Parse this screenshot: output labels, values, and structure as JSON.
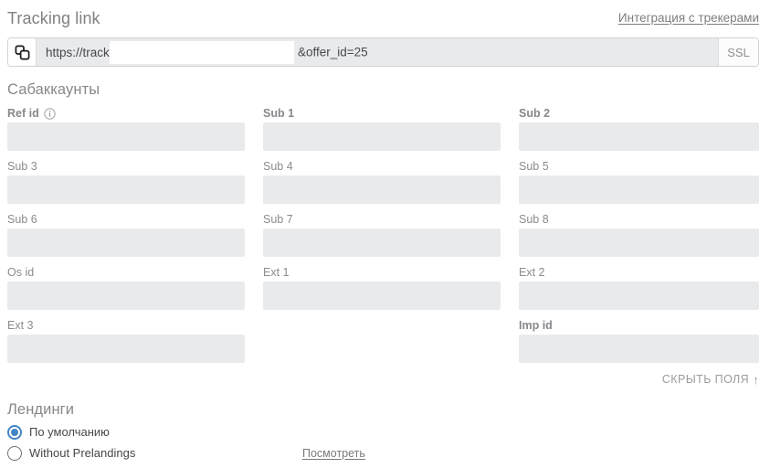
{
  "header": {
    "title": "Tracking link",
    "integration_link": "Интеграция с трекерами"
  },
  "tracking_link": {
    "copy_icon": "copy-icon",
    "url_prefix": "https://track.",
    "url_suffix": "&offer_id=25",
    "url_redacted": true,
    "ssl_label": "SSL"
  },
  "subaccounts": {
    "title": "Сабаккаунты",
    "hide_fields_label": "СКРЫТЬ ПОЛЯ",
    "hide_fields_arrow": "↑",
    "fields": [
      {
        "label": "Ref id",
        "value": "",
        "placeholder": "",
        "bold": true,
        "info_icon": "info-icon"
      },
      {
        "label": "Sub 1",
        "value": "",
        "placeholder": "",
        "bold": true
      },
      {
        "label": "Sub 2",
        "value": "",
        "placeholder": "",
        "bold": true
      },
      {
        "label": "Sub 3",
        "value": "",
        "placeholder": ""
      },
      {
        "label": "Sub 4",
        "value": "",
        "placeholder": ""
      },
      {
        "label": "Sub 5",
        "value": "",
        "placeholder": ""
      },
      {
        "label": "Sub 6",
        "value": "",
        "placeholder": ""
      },
      {
        "label": "Sub 7",
        "value": "",
        "placeholder": ""
      },
      {
        "label": "Sub 8",
        "value": "",
        "placeholder": ""
      },
      {
        "label": "Os id",
        "value": "",
        "placeholder": ""
      },
      {
        "label": "Ext 1",
        "value": "",
        "placeholder": ""
      },
      {
        "label": "Ext 2",
        "value": "",
        "placeholder": ""
      },
      {
        "label": "Ext 3",
        "value": "",
        "placeholder": ""
      },
      {
        "label": "",
        "value": null,
        "placeholder": "",
        "empty": true
      },
      {
        "label": "Imp id",
        "value": "",
        "placeholder": "",
        "bold": true
      }
    ]
  },
  "landings": {
    "title": "Лендинги",
    "options": [
      {
        "label": "По умолчанию",
        "selected": true
      },
      {
        "label": "Without Prelandings",
        "selected": false,
        "preview_label": "Посмотреть"
      }
    ]
  },
  "colors": {
    "accent": "#4285c5",
    "field_fill": "#e9eaec",
    "label_gray": "#86888b",
    "link_gray": "#7c7e81",
    "border": "#cfd2d5"
  }
}
